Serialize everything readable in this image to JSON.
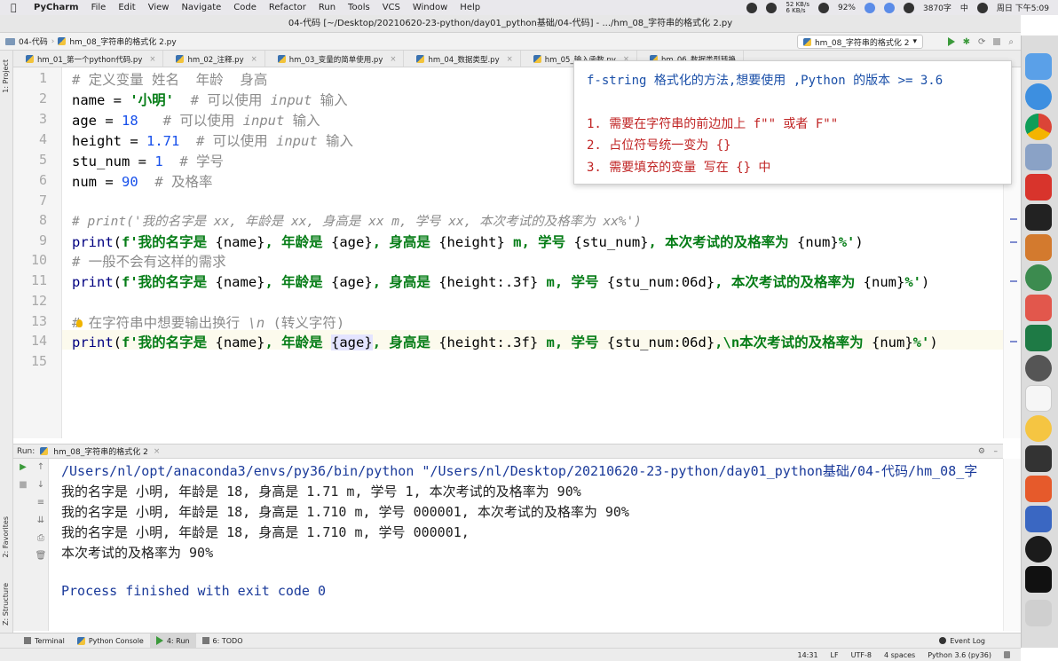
{
  "menubar": {
    "app_name": "PyCharm",
    "items": [
      "File",
      "Edit",
      "View",
      "Navigate",
      "Code",
      "Refactor",
      "Run",
      "Tools",
      "VCS",
      "Window",
      "Help"
    ],
    "net_up": "52 KB/s",
    "net_down": "6 KB/s",
    "battery": "92%",
    "word_count": "3870字",
    "input_method": "中",
    "clock": "周日 下午5:09"
  },
  "window": {
    "title": "04-代码 [~/Desktop/20210620-23-python/day01_python基础/04-代码] - .../hm_08_字符串的格式化 2.py"
  },
  "navbar": {
    "project": "04-代码",
    "file": "hm_08_字符串的格式化 2.py",
    "run_config": "hm_08_字符串的格式化 2"
  },
  "left_stripe": {
    "project": "1: Project",
    "favorites": "2: Favorites",
    "structure": "Z: Structure"
  },
  "tabs": [
    {
      "label": "hm_01_第一个python代码.py"
    },
    {
      "label": "hm_02_注释.py"
    },
    {
      "label": "hm_03_变量的简单使用.py"
    },
    {
      "label": "hm_04_数据类型.py"
    },
    {
      "label": "hm_05_输入函数.py"
    },
    {
      "label": "hm_06_数据类型转换"
    }
  ],
  "editor": {
    "line_numbers": [
      "1",
      "2",
      "3",
      "4",
      "5",
      "6",
      "7",
      "8",
      "9",
      "10",
      "11",
      "12",
      "13",
      "14",
      "15"
    ],
    "l1": "# 定义变量 姓名  年龄  身高",
    "l2_var": "name",
    "l2_eq": " = ",
    "l2_val": "'小明'",
    "l2_cmt": "  # 可以使用 ",
    "l2_cmt_i": "input",
    "l2_cmt_tail": " 输入",
    "l3_var": "age",
    "l3_eq": " = ",
    "l3_val": "18",
    "l3_cmt": "   # 可以使用 ",
    "l3_cmt_i": "input",
    "l3_cmt_tail": " 输入",
    "l4_var": "height",
    "l4_eq": " = ",
    "l4_val": "1.71",
    "l4_cmt": "  # 可以使用 ",
    "l4_cmt_i": "input",
    "l4_cmt_tail": " 输入",
    "l5_var": "stu_num",
    "l5_eq": " = ",
    "l5_val": "1",
    "l5_cmt": "  # 学号",
    "l6_var": "num",
    "l6_eq": " = ",
    "l6_val": "90",
    "l6_cmt": "  # 及格率",
    "l8": "# print('我的名字是 xx, 年龄是 xx, 身高是 xx m, 学号 xx, 本次考试的及格率为 xx%')",
    "l9_fn": "print",
    "l9_a": "(",
    "l9_b": "f'我的名字是 ",
    "l9_c": "{name}",
    "l9_d": ", 年龄是 ",
    "l9_e": "{age}",
    "l9_f": ", 身高是 ",
    "l9_g": "{height}",
    "l9_h": " m, 学号 ",
    "l9_i": "{stu_num}",
    "l9_j": ", 本次考试的及格率为 ",
    "l9_k": "{num}",
    "l9_l": "%'",
    "l9_m": ")",
    "l10": "# 一般不会有这样的需求",
    "l11_fn": "print",
    "l11_a": "(",
    "l11_b": "f'我的名字是 ",
    "l11_c": "{name}",
    "l11_d": ", 年龄是 ",
    "l11_e": "{age}",
    "l11_f": ", 身高是 ",
    "l11_g": "{height:.3f}",
    "l11_h": " m, 学号 ",
    "l11_i": "{stu_num:06d}",
    "l11_j": ", 本次考试的及格率为 ",
    "l11_k": "{num}",
    "l11_l": "%'",
    "l11_m": ")",
    "l13_a": "# 在字符串中想要输出换行 ",
    "l13_b": "\\n",
    "l13_c": " (转义字符)",
    "l14_fn": "print",
    "l14_a": "(",
    "l14_b": "f'我的名字是 ",
    "l14_c": "{name}",
    "l14_d": ", 年龄是 ",
    "l14_e": "{age}",
    "l14_f": ", 身高是 ",
    "l14_g": "{height:.3f}",
    "l14_h": " m, 学号 ",
    "l14_i": "{stu_num:06d}",
    "l14_j": ",\\n本次考试的及格率为 ",
    "l14_k": "{num}",
    "l14_l": "%'",
    "l14_m": ")"
  },
  "doc_popup": {
    "head": "f-string 格式化的方法,想要使用 ,Python 的版本 >= 3.6",
    "item1": "1. 需要在字符串的前边加上 f\"\" 或者 F\"\"",
    "item2": "2. 占位符号统一变为 {}",
    "item3": "3. 需要填充的变量 写在 {} 中"
  },
  "run_panel": {
    "label": "Run:",
    "tab": "hm_08_字符串的格式化 2",
    "output": [
      "/Users/nl/opt/anaconda3/envs/py36/bin/python \"/Users/nl/Desktop/20210620-23-python/day01_python基础/04-代码/hm_08_字",
      "我的名字是 小明, 年龄是 18, 身高是 1.71 m, 学号 1, 本次考试的及格率为 90%",
      "我的名字是 小明, 年龄是 18, 身高是 1.710 m, 学号 000001, 本次考试的及格率为 90%",
      "我的名字是 小明, 年龄是 18, 身高是 1.710 m, 学号 000001,",
      "本次考试的及格率为 90%",
      "Process finished with exit code 0"
    ]
  },
  "toolwindows": {
    "terminal": "Terminal",
    "python_console": "Python Console",
    "run": "4: Run",
    "todo": "6: TODO",
    "event_log": "Event Log"
  },
  "statusbar": {
    "position": "14:31",
    "line_sep": "LF",
    "encoding": "UTF-8",
    "indent": "4 spaces",
    "interpreter": "Python 3.6 (py36)"
  },
  "colors": {
    "keyword": "#1a1aa6",
    "string": "#067d17",
    "number": "#1750eb",
    "comment": "#8c8c8c",
    "doc_head": "#1a4fa8",
    "doc_item": "#c02424"
  }
}
